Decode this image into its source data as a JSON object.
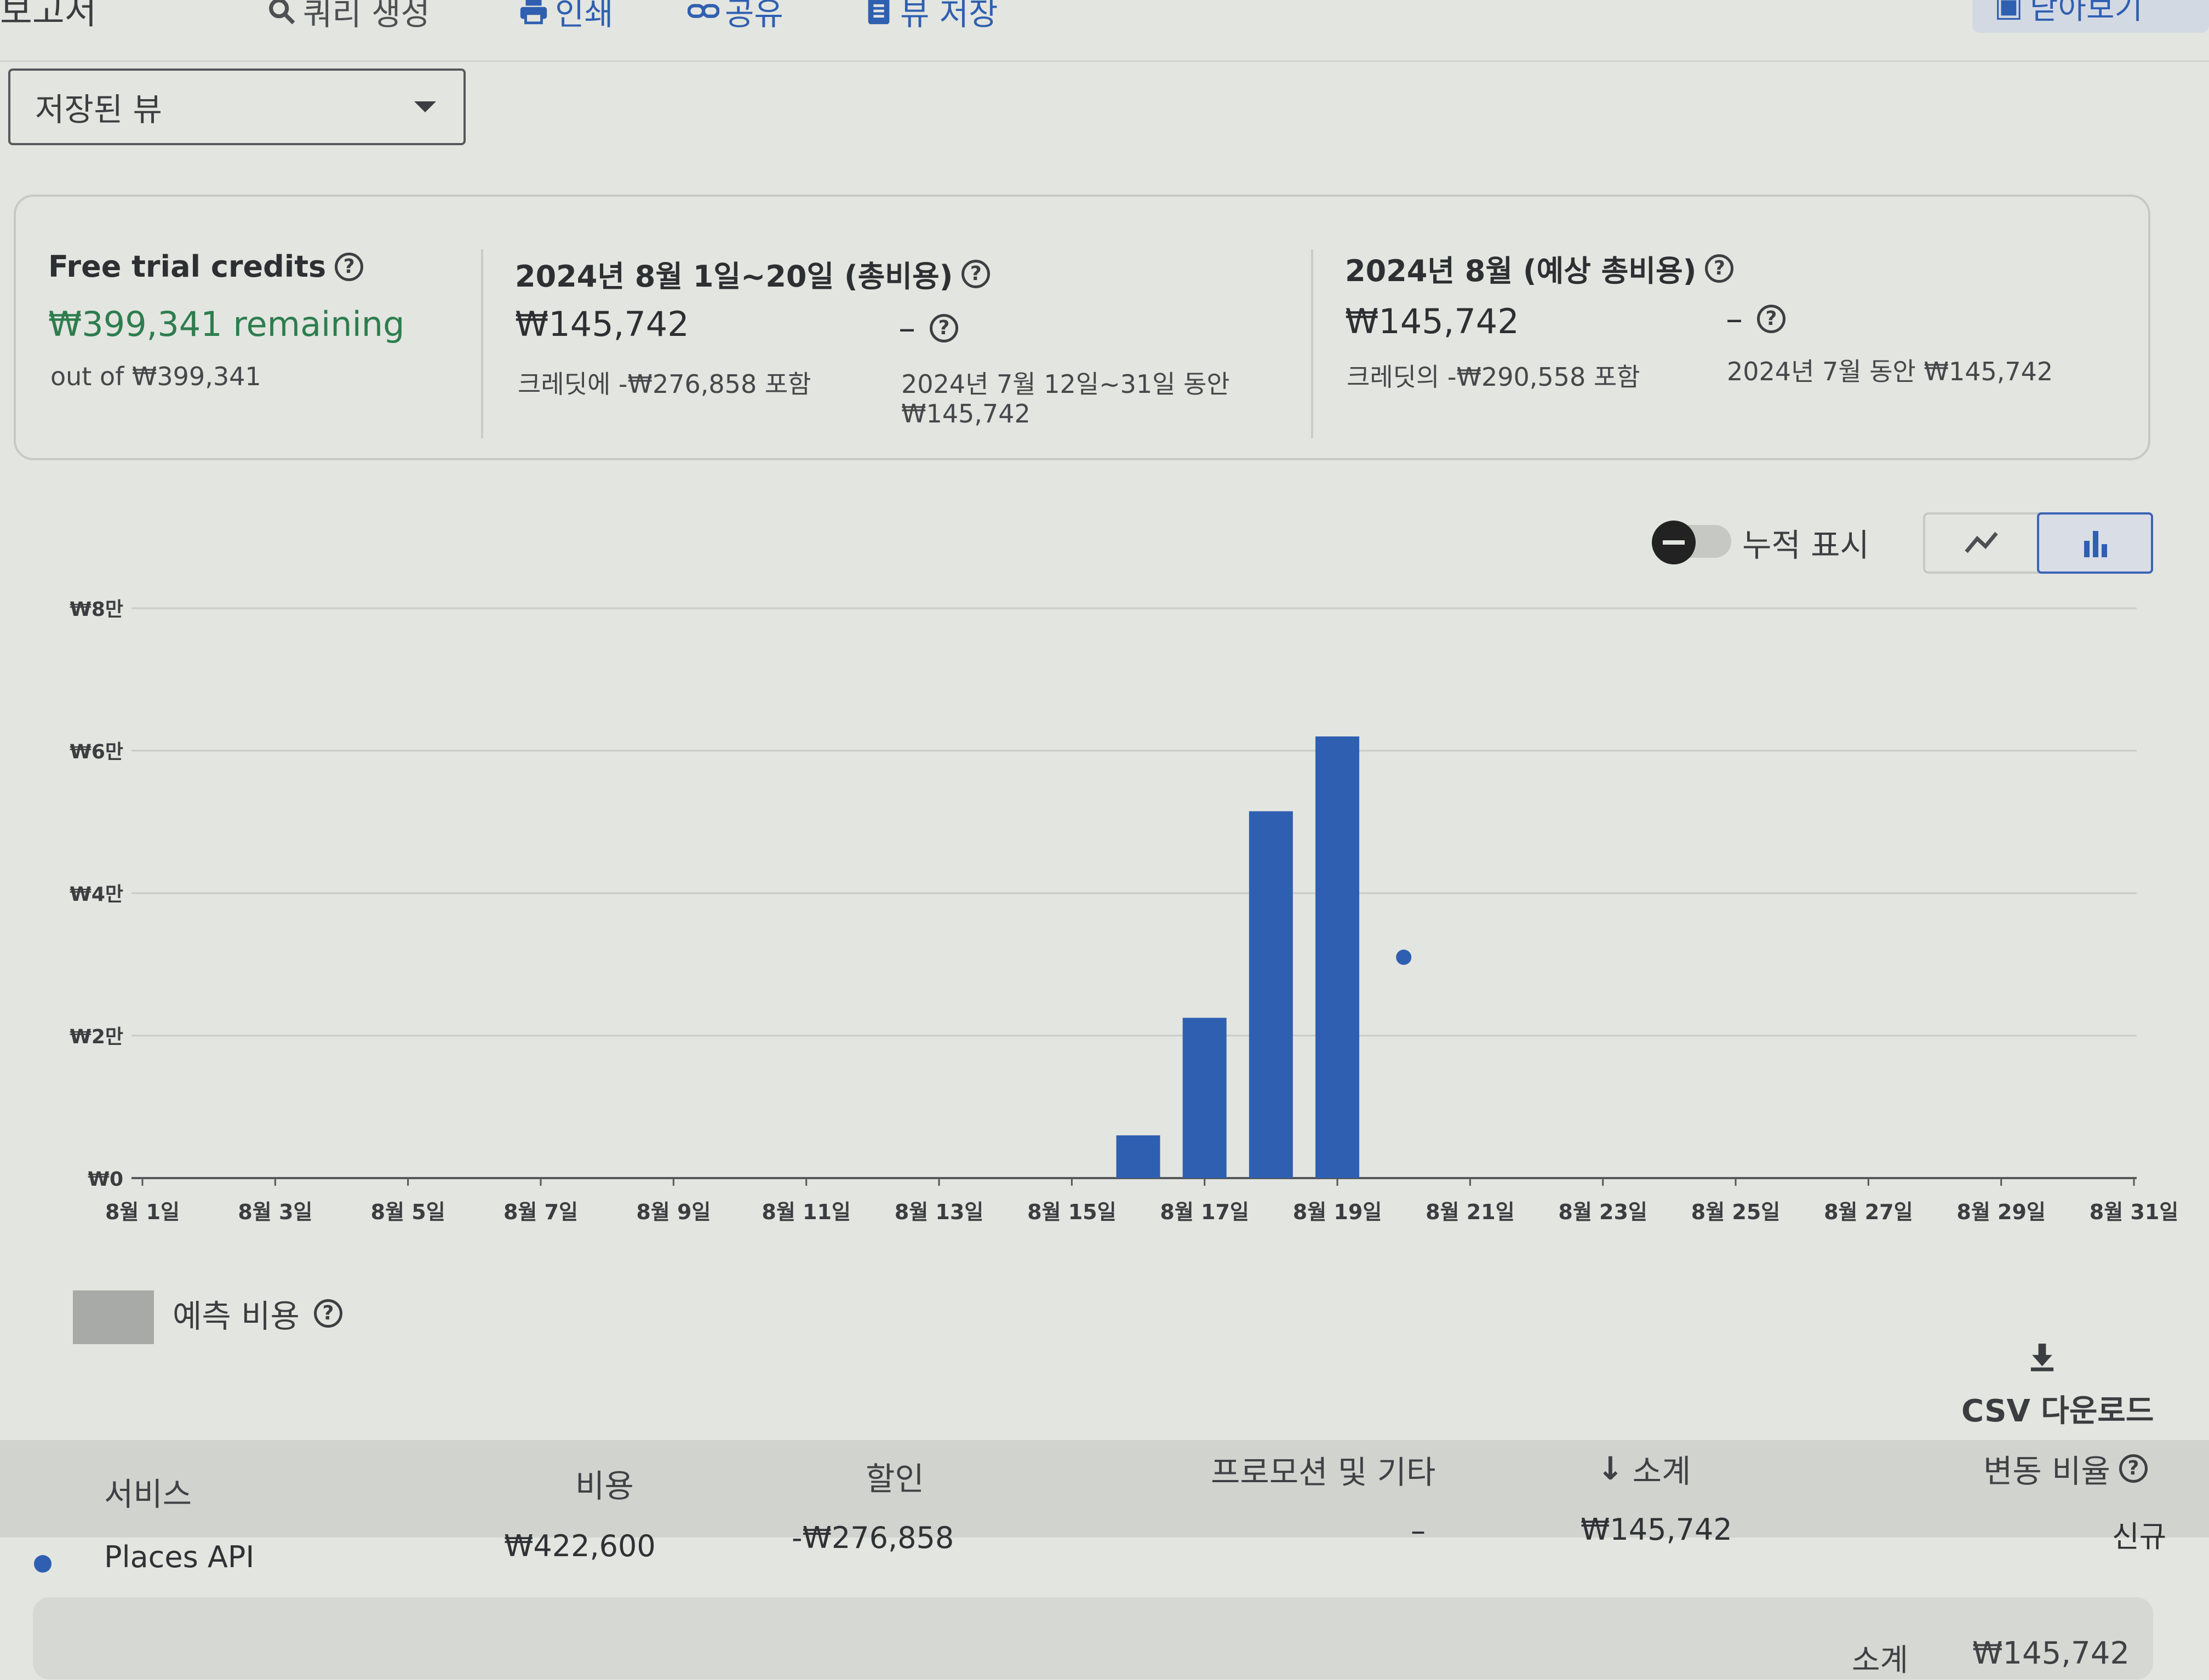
{
  "toolbar": {
    "title": "보고서",
    "query": "쿼리 생성",
    "print": "인쇄",
    "share": "공유",
    "save_view": "뷰 저장",
    "right_button": "닫아보기"
  },
  "saved_view": {
    "label": "저장된 뷰"
  },
  "summary": {
    "credits": {
      "title": "Free trial credits",
      "remaining": "₩399,341 remaining",
      "total": "out of ₩399,341"
    },
    "period": {
      "title": "2024년 8월 1일~20일 (총비용)",
      "amount": "₩145,742",
      "credit_note": "크레딧에 -₩276,858 포함",
      "comparison_value": "–",
      "comparison_text": "2024년 7월 12일~31일 동안",
      "comparison_amount": "₩145,742"
    },
    "forecast": {
      "title": "2024년 8월 (예상 총비용)",
      "amount": "₩145,742",
      "credit_note": "크레딧의 -₩290,558 포함",
      "comparison_value": "–",
      "comparison_text": "2024년 7월 동안 ₩145,742"
    }
  },
  "chart_controls": {
    "cumulative_label": "누적 표시",
    "cumulative_on": false,
    "selected_view": "bar"
  },
  "chart_data": {
    "type": "bar",
    "ylim": [
      0,
      80000
    ],
    "y_ticks": [
      {
        "value": 0,
        "label": "₩0"
      },
      {
        "value": 20000,
        "label": "₩2만"
      },
      {
        "value": 40000,
        "label": "₩4만"
      },
      {
        "value": 60000,
        "label": "₩6만"
      },
      {
        "value": 80000,
        "label": "₩8만"
      }
    ],
    "x_tick_labels": [
      "8월 1일",
      "8월 3일",
      "8월 5일",
      "8월 7일",
      "8월 9일",
      "8월 11일",
      "8월 13일",
      "8월 15일",
      "8월 17일",
      "8월 19일",
      "8월 21일",
      "8월 23일",
      "8월 25일",
      "8월 27일",
      "8월 29일",
      "8월 31일"
    ],
    "days_in_month": 31,
    "series": [
      {
        "name": "Places API",
        "color": "#2f5fb0",
        "points": [
          {
            "day": 16,
            "value": 6000
          },
          {
            "day": 17,
            "value": 22500
          },
          {
            "day": 18,
            "value": 51500
          },
          {
            "day": 19,
            "value": 62000
          }
        ]
      }
    ],
    "forecast_points": [
      {
        "day": 20,
        "value": 31000
      }
    ],
    "grid": true
  },
  "legend": {
    "label": "예측 비용",
    "swatch_color": "#a7aaa6"
  },
  "csv": {
    "label": "CSV 다운로드"
  },
  "table": {
    "headers": {
      "service": "서비스",
      "cost": "비용",
      "discount": "할인",
      "promotion": "프로모션 및 기타",
      "subtotal": "소계",
      "change": "변동 비율"
    },
    "rows": [
      {
        "service": "Places API",
        "cost": "₩422,600",
        "discount": "-₩276,858",
        "promotion": "–",
        "subtotal": "₩145,742",
        "change": "신규"
      }
    ],
    "footer": {
      "label": "소계",
      "value": "₩145,742"
    }
  }
}
